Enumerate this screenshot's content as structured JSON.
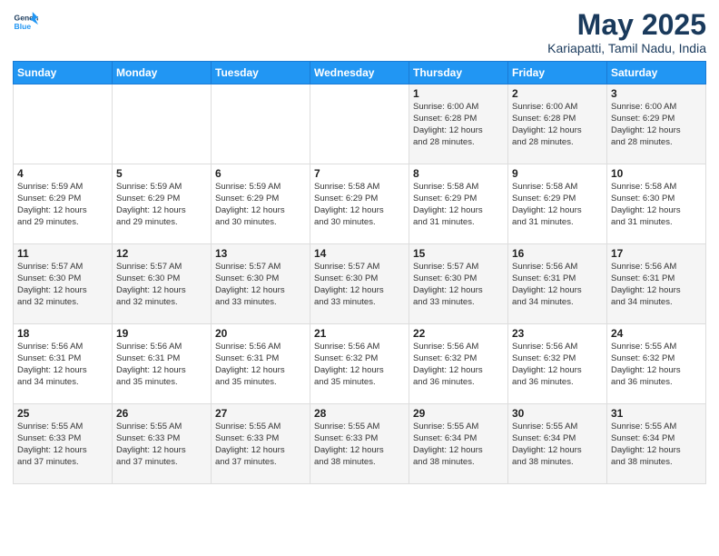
{
  "logo": {
    "line1": "General",
    "line2": "Blue"
  },
  "title": "May 2025",
  "subtitle": "Kariapatti, Tamil Nadu, India",
  "days_header": [
    "Sunday",
    "Monday",
    "Tuesday",
    "Wednesday",
    "Thursday",
    "Friday",
    "Saturday"
  ],
  "weeks": [
    [
      {
        "day": "",
        "text": ""
      },
      {
        "day": "",
        "text": ""
      },
      {
        "day": "",
        "text": ""
      },
      {
        "day": "",
        "text": ""
      },
      {
        "day": "1",
        "text": "Sunrise: 6:00 AM\nSunset: 6:28 PM\nDaylight: 12 hours\nand 28 minutes."
      },
      {
        "day": "2",
        "text": "Sunrise: 6:00 AM\nSunset: 6:28 PM\nDaylight: 12 hours\nand 28 minutes."
      },
      {
        "day": "3",
        "text": "Sunrise: 6:00 AM\nSunset: 6:29 PM\nDaylight: 12 hours\nand 28 minutes."
      }
    ],
    [
      {
        "day": "4",
        "text": "Sunrise: 5:59 AM\nSunset: 6:29 PM\nDaylight: 12 hours\nand 29 minutes."
      },
      {
        "day": "5",
        "text": "Sunrise: 5:59 AM\nSunset: 6:29 PM\nDaylight: 12 hours\nand 29 minutes."
      },
      {
        "day": "6",
        "text": "Sunrise: 5:59 AM\nSunset: 6:29 PM\nDaylight: 12 hours\nand 30 minutes."
      },
      {
        "day": "7",
        "text": "Sunrise: 5:58 AM\nSunset: 6:29 PM\nDaylight: 12 hours\nand 30 minutes."
      },
      {
        "day": "8",
        "text": "Sunrise: 5:58 AM\nSunset: 6:29 PM\nDaylight: 12 hours\nand 31 minutes."
      },
      {
        "day": "9",
        "text": "Sunrise: 5:58 AM\nSunset: 6:29 PM\nDaylight: 12 hours\nand 31 minutes."
      },
      {
        "day": "10",
        "text": "Sunrise: 5:58 AM\nSunset: 6:30 PM\nDaylight: 12 hours\nand 31 minutes."
      }
    ],
    [
      {
        "day": "11",
        "text": "Sunrise: 5:57 AM\nSunset: 6:30 PM\nDaylight: 12 hours\nand 32 minutes."
      },
      {
        "day": "12",
        "text": "Sunrise: 5:57 AM\nSunset: 6:30 PM\nDaylight: 12 hours\nand 32 minutes."
      },
      {
        "day": "13",
        "text": "Sunrise: 5:57 AM\nSunset: 6:30 PM\nDaylight: 12 hours\nand 33 minutes."
      },
      {
        "day": "14",
        "text": "Sunrise: 5:57 AM\nSunset: 6:30 PM\nDaylight: 12 hours\nand 33 minutes."
      },
      {
        "day": "15",
        "text": "Sunrise: 5:57 AM\nSunset: 6:30 PM\nDaylight: 12 hours\nand 33 minutes."
      },
      {
        "day": "16",
        "text": "Sunrise: 5:56 AM\nSunset: 6:31 PM\nDaylight: 12 hours\nand 34 minutes."
      },
      {
        "day": "17",
        "text": "Sunrise: 5:56 AM\nSunset: 6:31 PM\nDaylight: 12 hours\nand 34 minutes."
      }
    ],
    [
      {
        "day": "18",
        "text": "Sunrise: 5:56 AM\nSunset: 6:31 PM\nDaylight: 12 hours\nand 34 minutes."
      },
      {
        "day": "19",
        "text": "Sunrise: 5:56 AM\nSunset: 6:31 PM\nDaylight: 12 hours\nand 35 minutes."
      },
      {
        "day": "20",
        "text": "Sunrise: 5:56 AM\nSunset: 6:31 PM\nDaylight: 12 hours\nand 35 minutes."
      },
      {
        "day": "21",
        "text": "Sunrise: 5:56 AM\nSunset: 6:32 PM\nDaylight: 12 hours\nand 35 minutes."
      },
      {
        "day": "22",
        "text": "Sunrise: 5:56 AM\nSunset: 6:32 PM\nDaylight: 12 hours\nand 36 minutes."
      },
      {
        "day": "23",
        "text": "Sunrise: 5:56 AM\nSunset: 6:32 PM\nDaylight: 12 hours\nand 36 minutes."
      },
      {
        "day": "24",
        "text": "Sunrise: 5:55 AM\nSunset: 6:32 PM\nDaylight: 12 hours\nand 36 minutes."
      }
    ],
    [
      {
        "day": "25",
        "text": "Sunrise: 5:55 AM\nSunset: 6:33 PM\nDaylight: 12 hours\nand 37 minutes."
      },
      {
        "day": "26",
        "text": "Sunrise: 5:55 AM\nSunset: 6:33 PM\nDaylight: 12 hours\nand 37 minutes."
      },
      {
        "day": "27",
        "text": "Sunrise: 5:55 AM\nSunset: 6:33 PM\nDaylight: 12 hours\nand 37 minutes."
      },
      {
        "day": "28",
        "text": "Sunrise: 5:55 AM\nSunset: 6:33 PM\nDaylight: 12 hours\nand 38 minutes."
      },
      {
        "day": "29",
        "text": "Sunrise: 5:55 AM\nSunset: 6:34 PM\nDaylight: 12 hours\nand 38 minutes."
      },
      {
        "day": "30",
        "text": "Sunrise: 5:55 AM\nSunset: 6:34 PM\nDaylight: 12 hours\nand 38 minutes."
      },
      {
        "day": "31",
        "text": "Sunrise: 5:55 AM\nSunset: 6:34 PM\nDaylight: 12 hours\nand 38 minutes."
      }
    ]
  ]
}
